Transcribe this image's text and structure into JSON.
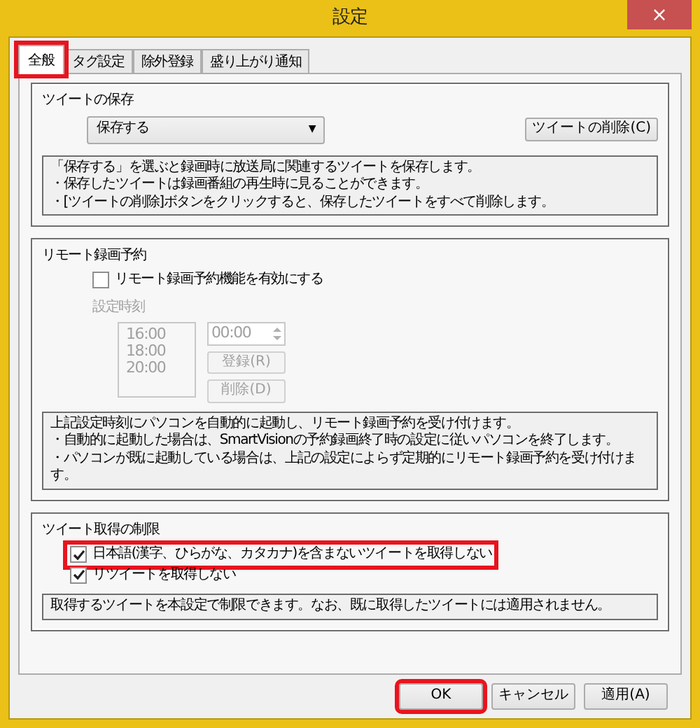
{
  "window": {
    "title": "設定",
    "close": "×"
  },
  "tabs": [
    {
      "label": "全般",
      "selected": true,
      "highlighted": true
    },
    {
      "label": "タグ設定",
      "selected": false,
      "highlighted": false
    },
    {
      "label": "除外登録",
      "selected": false,
      "highlighted": false
    },
    {
      "label": "盛り上がり通知",
      "selected": false,
      "highlighted": false
    }
  ],
  "tweet_storage": {
    "title": "ツイートの保存",
    "dropdown": {
      "value": "保存する",
      "arrow": "▼"
    },
    "delete_button": "ツイートの削除(C)",
    "description": [
      "「保存する」を選ぶと録画時に放送局に関連するツイートを保存します。",
      "・保存したツイートは録画番組の再生時に見ることができます。",
      "・[ツイートの削除]ボタンをクリックすると、保存したツイートをすべて削除します。"
    ]
  },
  "remote_recording": {
    "title": "リモート録画予約",
    "checkbox": {
      "label": "リモート録画予約機能を有効にする",
      "checked": false
    },
    "time_section": {
      "disabled": true,
      "label": "設定時刻",
      "times": [
        "16:00",
        "18:00",
        "20:00"
      ],
      "time_input": "00:00",
      "register_button": "登録(R)",
      "delete_button": "削除(D)"
    },
    "description": [
      "上記設定時刻にパソコンを自動的に起動し、リモート録画予約を受け付けます。",
      "・自動的に起動した場合は、SmartVisionの予約録画終了時の設定に従いパソコンを終了します。",
      "・パソコンが既に起動している場合は、上記の設定によらず定期的にリモート録画予約を受け付けます。"
    ]
  },
  "tweet_limit": {
    "title": "ツイート取得の制限",
    "checkboxes": [
      {
        "label": "日本語(漢字、ひらがな、カタカナ)を含まないツイートを取得しない",
        "checked": true,
        "highlighted": true
      },
      {
        "label": "リツイートを取得しない",
        "checked": true,
        "highlighted": false
      }
    ],
    "description": "取得するツイートを本設定で制限できます。なお、既に取得したツイートには適用されません。"
  },
  "buttons": [
    {
      "label": "OK",
      "highlighted": true
    },
    {
      "label": "キャンセル",
      "highlighted": false
    },
    {
      "label": "適用(A)",
      "highlighted": false
    }
  ]
}
